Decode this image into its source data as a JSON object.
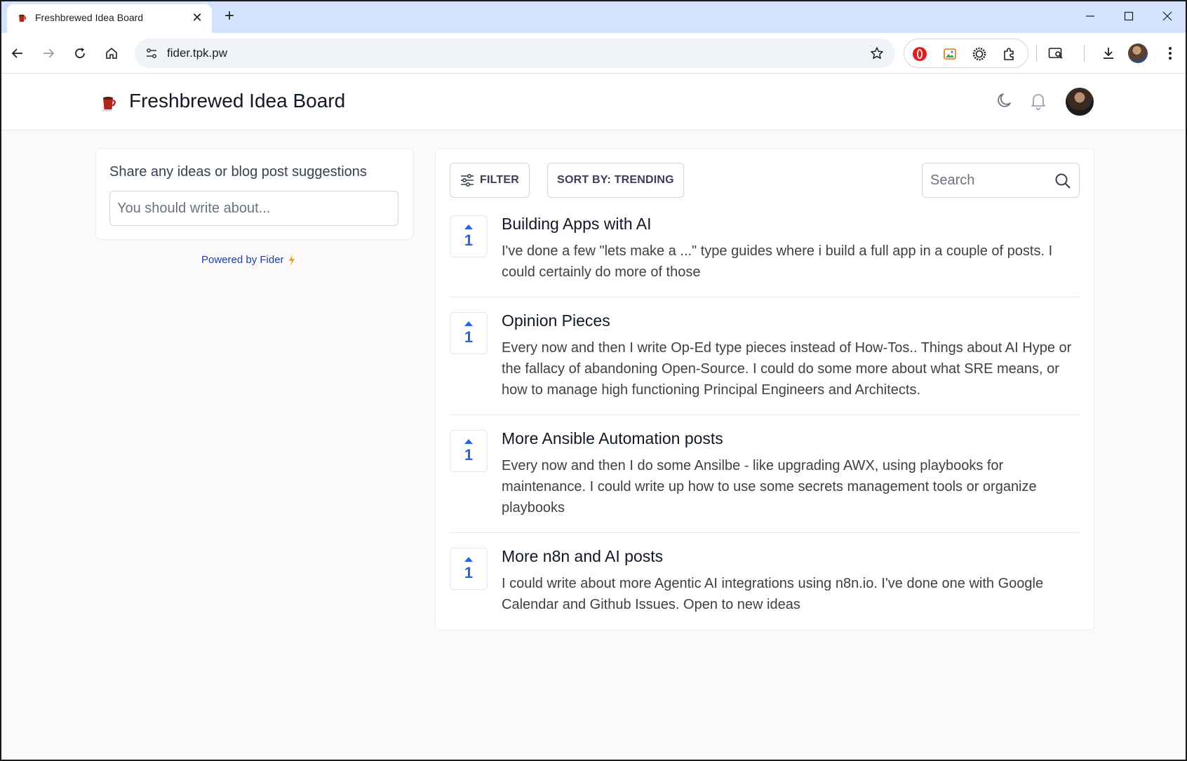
{
  "browser": {
    "tab_title": "Freshbrewed Idea Board",
    "url": "fider.tpk.pw"
  },
  "site": {
    "title": "Freshbrewed Idea Board"
  },
  "share": {
    "label": "Share any ideas or blog post suggestions",
    "placeholder": "You should write about..."
  },
  "powered_by": "Powered by Fider",
  "toolbar": {
    "filter_label": "FILTER",
    "sort_label": "SORT BY: TRENDING",
    "search_placeholder": "Search"
  },
  "posts": [
    {
      "votes": "1",
      "title": "Building Apps with AI",
      "description": "I've done a few \"lets make a ...\" type guides where i build a full app in a couple of posts. I could certainly do more of those"
    },
    {
      "votes": "1",
      "title": "Opinion Pieces",
      "description": "Every now and then I write Op-Ed type pieces instead of How-Tos.. Things about AI Hype or the fallacy of abandoning Open-Source. I could do some more about what SRE means, or how to manage high functioning Principal Engineers and Architects."
    },
    {
      "votes": "1",
      "title": "More Ansible Automation posts",
      "description": "Every now and then I do some Ansilbe - like upgrading AWX, using playbooks for maintenance. I could write up how to use some secrets management tools or organize playbooks"
    },
    {
      "votes": "1",
      "title": "More n8n and AI posts",
      "description": "I could write about more Agentic AI integrations using n8n.io. I've done one with Google Calendar and Github Issues. Open to new ideas"
    }
  ],
  "colors": {
    "accent": "#2563eb",
    "tab_strip": "#d3e3fd",
    "page_bg": "#fbf9f9"
  }
}
